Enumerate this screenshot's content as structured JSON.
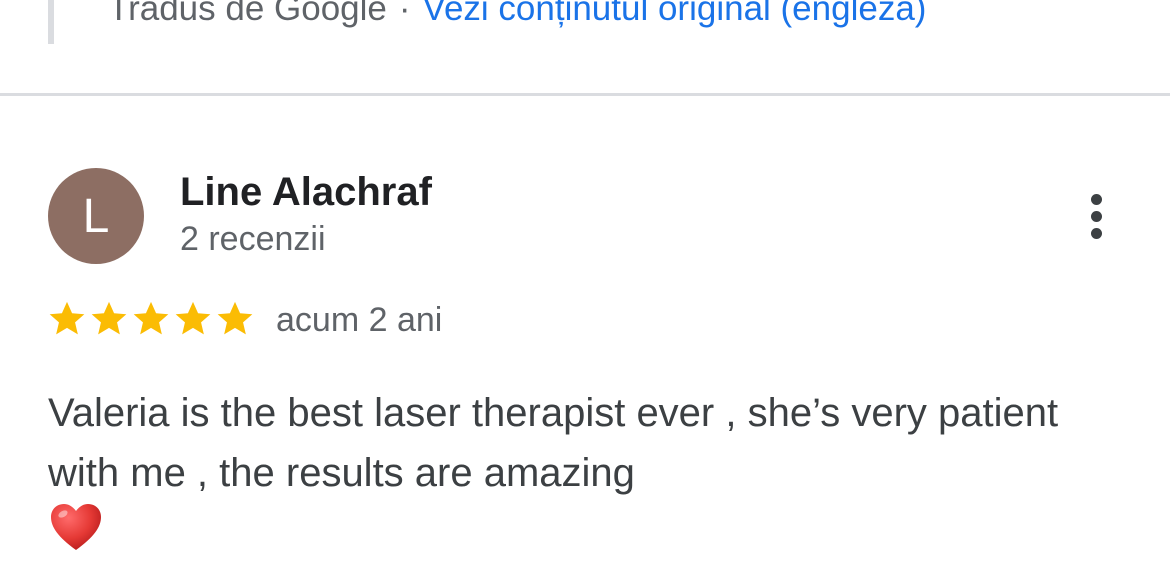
{
  "translation": {
    "translated_by": "Tradus de Google",
    "separator": "·",
    "view_original": "Vezi conținutul original (engleză)"
  },
  "review": {
    "avatar_letter": "L",
    "avatar_color": "#8d6e63",
    "reviewer_name": "Line Alachraf",
    "review_count": "2 recenzii",
    "rating": 5,
    "rating_max": 5,
    "star_color": "#fbbc04",
    "time": "acum 2 ani",
    "text": "Valeria is the best laser therapist ever , she’s very patient with me , the results are amazing",
    "emoji_icon": "red-heart-icon"
  }
}
